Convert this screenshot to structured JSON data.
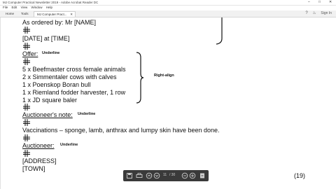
{
  "window": {
    "title": "MJ Computer Practical Newsletter 2019 - Adobe Acrobat Reader DC"
  },
  "menu": [
    "File",
    "Edit",
    "View",
    "Window",
    "Help"
  ],
  "tabs": [
    {
      "label": "Home"
    },
    {
      "label": "Tools"
    },
    {
      "label": "MJ Computer Pract..."
    }
  ],
  "header_right": {
    "signin_label": "Sign In"
  },
  "document": {
    "ordered_by": "As ordered by: Mr [NAME]",
    "date_time": "[DATE] at [TIME]",
    "offer_label": "Offer:",
    "offer_note": "Underline",
    "items": [
      "5 x Beefmaster cross female animals",
      "2 x Simmentaler cows with calves",
      "1 x Poenskop Boran bull",
      "1 x Riemland fodder harvester, 1 row",
      "1 x JD square baler"
    ],
    "items_note": "Right-align",
    "auctioneer_note_label": "Auctioneer's note:",
    "auctioneer_note_note": "Underline",
    "vaccinations": "Vaccinations – sponge, lamb, anthrax and lumpy skin have been done.",
    "auctioneer_label": "Auctioneer:",
    "auctioneer_note": "Underline",
    "address": "[ADDRESS]",
    "town": "[TOWN]",
    "page_number": "(19)"
  },
  "toolbar": {
    "page_current": "11",
    "page_total": "/ 30"
  },
  "colors": {
    "toolbar_bg": "#3a3a3a",
    "brace": "#111111"
  }
}
